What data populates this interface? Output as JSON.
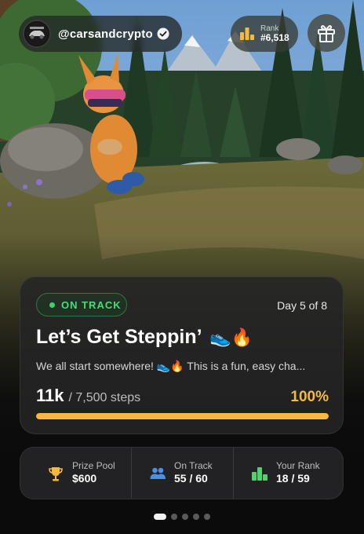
{
  "header": {
    "username": "@carsandcrypto",
    "rank_label": "Rank",
    "rank_value": "#6,518"
  },
  "challenge": {
    "status": "ON TRACK",
    "day": "Day 5 of 8",
    "title": "Let’s Get Steppin’",
    "title_emoji": "👟🔥",
    "description": "We all start somewhere! 👟🔥 This is a fun, easy cha...",
    "steps_value": "11k",
    "steps_goal": "/ 7,500 steps",
    "percent": "100%",
    "progress_fraction": 1.0
  },
  "stats": [
    {
      "label": "Prize Pool",
      "value": "$600",
      "icon": "trophy-icon"
    },
    {
      "label": "On Track",
      "value": "55 / 60",
      "icon": "people-icon"
    },
    {
      "label": "Your Rank",
      "value": "18 / 59",
      "icon": "podium-icon"
    }
  ],
  "pagination": {
    "count": 5,
    "active_index": 0
  },
  "colors": {
    "accent_gold": "#f4b942",
    "status_green": "#44de73",
    "podium_green": "#4fd36a",
    "people_blue": "#4c8ee8"
  }
}
